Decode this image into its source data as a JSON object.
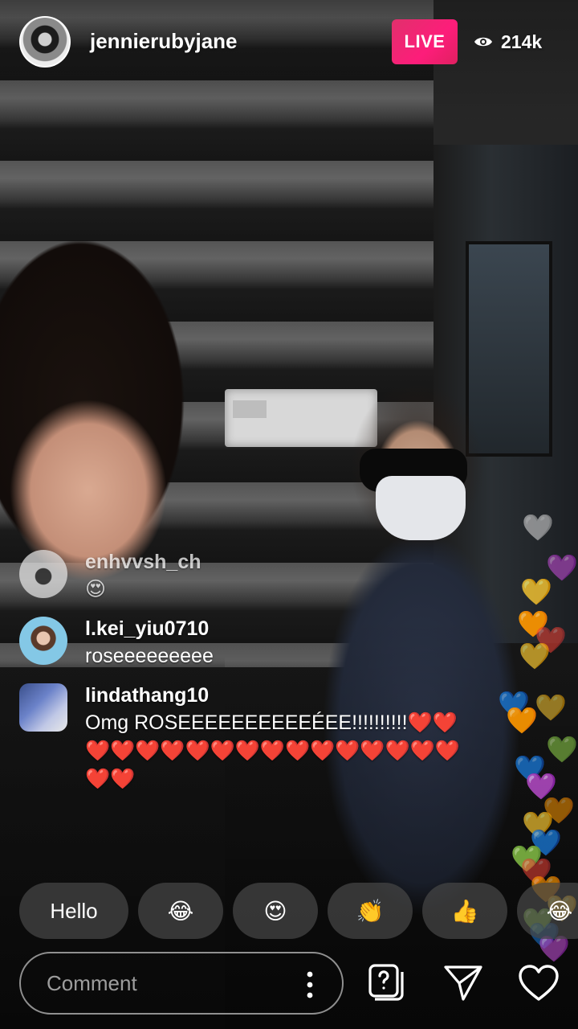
{
  "header": {
    "username": "jennierubyjane",
    "live_label": "LIVE",
    "viewer_count": "214k",
    "icons": {
      "avatar": "host-avatar",
      "eye": "eye-icon"
    }
  },
  "comments": [
    {
      "username": "enhvvsh_ch",
      "text": "😍"
    },
    {
      "username": "l.kei_yiu0710",
      "text": "roseeeeeeeee"
    },
    {
      "username": "lindathang10",
      "text": "Omg ROSEEEEEEEEEEÉEE!!!!!!!!!!❤️❤️❤️❤️❤️❤️❤️❤️❤️❤️❤️❤️❤️❤️❤️❤️❤️❤️❤️"
    }
  ],
  "quick_reactions": [
    "Hello",
    "😂",
    "😍",
    "👏",
    "👍",
    "😂"
  ],
  "bottom_bar": {
    "comment_placeholder": "Comment",
    "icons": [
      "more-vertical-icon",
      "question-box-icon",
      "send-icon",
      "heart-outline-icon"
    ]
  },
  "floating_hearts": [
    "🤍",
    "💜",
    "💛",
    "🧡",
    "❤️",
    "💛",
    "💙",
    "🧡",
    "💛",
    "💚",
    "💙",
    "💜",
    "🧡",
    "💛",
    "💙",
    "💚",
    "❤️",
    "🧡",
    "💛",
    "💚",
    "💙",
    "💜"
  ],
  "colors": {
    "live_badge": "#e1306c",
    "chip_bg": "#464646"
  }
}
